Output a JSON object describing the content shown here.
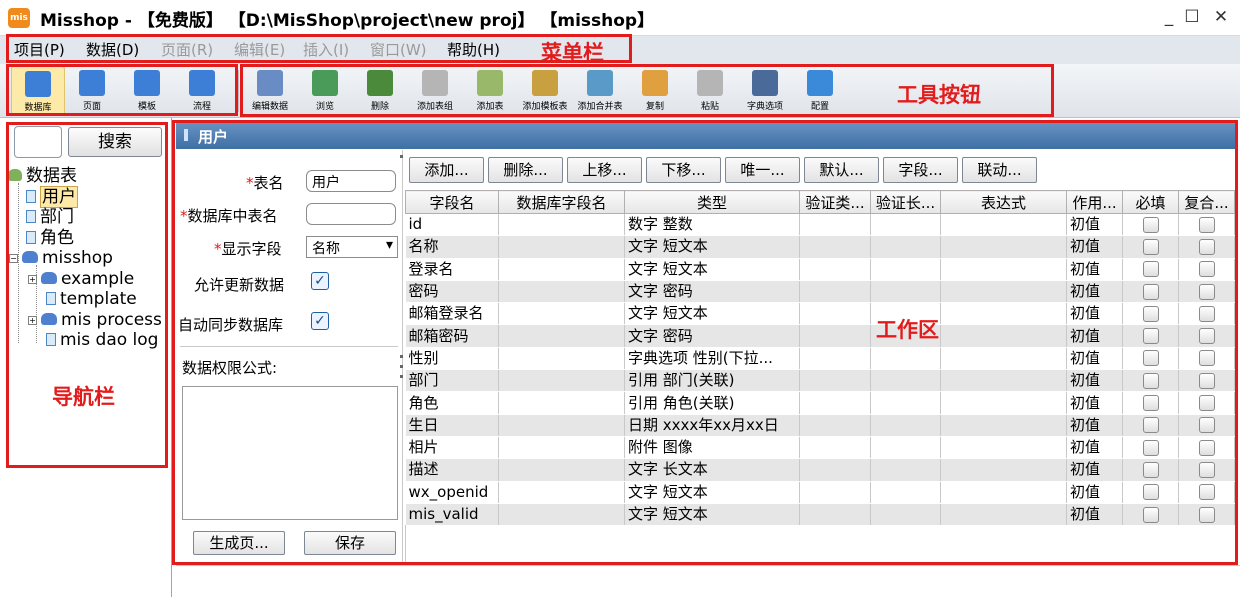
{
  "window": {
    "logo": "mis",
    "title": "Misshop - 【免费版】 【D:\\MisShop\\project\\new proj】 【misshop】",
    "min": "_",
    "max": "☐",
    "close": "✕"
  },
  "menu": {
    "items": [
      {
        "label": "项目(P)"
      },
      {
        "label": "数据(D)"
      },
      {
        "label": "页面(R)"
      },
      {
        "label": "编辑(E)"
      },
      {
        "label": "插入(I)"
      },
      {
        "label": "窗口(W)"
      },
      {
        "label": "帮助(H)"
      }
    ]
  },
  "toolbar": {
    "nav_buttons": [
      {
        "label": "数据库",
        "icon": "database-icon",
        "color": "#3d7fd6"
      },
      {
        "label": "页面",
        "icon": "page-icon",
        "color": "#3d7fd6"
      },
      {
        "label": "模板",
        "icon": "template-icon",
        "color": "#3d7fd6"
      },
      {
        "label": "流程",
        "icon": "flow-icon",
        "color": "#3d7fd6"
      }
    ],
    "tool_buttons": [
      {
        "label": "编辑数据",
        "icon": "edit-data-icon",
        "color": "#6a8cc5"
      },
      {
        "label": "浏览",
        "icon": "browse-icon",
        "color": "#4a9a5a"
      },
      {
        "label": "删除",
        "icon": "delete-icon",
        "color": "#4a8a3a"
      },
      {
        "label": "添加表组",
        "icon": "add-group-icon",
        "color": "#b5b5b5"
      },
      {
        "label": "添加表",
        "icon": "add-table-icon",
        "color": "#9ab86a"
      },
      {
        "label": "添加模板表",
        "icon": "add-template-table-icon",
        "color": "#c9a040"
      },
      {
        "label": "添加合并表",
        "icon": "add-merge-table-icon",
        "color": "#5a9ac9"
      },
      {
        "label": "复制",
        "icon": "copy-icon",
        "color": "#e0a040"
      },
      {
        "label": "粘贴",
        "icon": "paste-icon",
        "color": "#b5b5b5"
      },
      {
        "label": "字典选项",
        "icon": "dictionary-icon",
        "color": "#4a6a9a"
      },
      {
        "label": "配置",
        "icon": "config-icon",
        "color": "#3a8ad9"
      }
    ]
  },
  "annotations": {
    "menubar": "菜单栏",
    "toolbar": "工具按钮",
    "navbar": "导航栏",
    "workarea": "工作区"
  },
  "nav": {
    "search_button": "搜索",
    "tree": [
      {
        "label": "数据表"
      },
      {
        "label": "用户"
      },
      {
        "label": "部门"
      },
      {
        "label": "角色"
      },
      {
        "label": "misshop"
      },
      {
        "label": "example"
      },
      {
        "label": "template"
      },
      {
        "label": "mis process"
      },
      {
        "label": "mis dao log"
      }
    ]
  },
  "main": {
    "title": "用户"
  },
  "form": {
    "table_name_label": "表名",
    "table_name_value": "用户",
    "db_table_name_label": "数据库中表名",
    "db_table_name_value": "",
    "display_field_label": "显示字段",
    "display_field_value": "名称",
    "allow_update_label": "允许更新数据",
    "auto_sync_label": "自动同步数据库",
    "checkmark": "✓",
    "data_permission_label": "数据权限公式:",
    "generate_page_button": "生成页...",
    "save_button": "保存"
  },
  "grid_toolbar": {
    "buttons": [
      "添加...",
      "删除...",
      "上移...",
      "下移...",
      "唯一...",
      "默认...",
      "字段...",
      "联动..."
    ]
  },
  "grid": {
    "columns": [
      "字段名",
      "数据库字段名",
      "类型",
      "验证类...",
      "验证长...",
      "表达式",
      "作用...",
      "必填",
      "复合..."
    ],
    "rows": [
      {
        "field": "id",
        "db_field": "",
        "type": "数字   整数",
        "scope": "初值"
      },
      {
        "field": "名称",
        "db_field": "",
        "type": "文字   短文本",
        "scope": "初值"
      },
      {
        "field": "登录名",
        "db_field": "",
        "type": "文字   短文本",
        "scope": "初值"
      },
      {
        "field": "密码",
        "db_field": "",
        "type": "文字   密码",
        "scope": "初值"
      },
      {
        "field": "邮箱登录名",
        "db_field": "",
        "type": "文字   短文本",
        "scope": "初值"
      },
      {
        "field": "邮箱密码",
        "db_field": "",
        "type": "文字   密码",
        "scope": "初值"
      },
      {
        "field": "性别",
        "db_field": "",
        "type": "字典选项   性别(下拉...",
        "scope": "初值"
      },
      {
        "field": "部门",
        "db_field": "",
        "type": "引用   部门(关联)",
        "scope": "初值"
      },
      {
        "field": "角色",
        "db_field": "",
        "type": "引用   角色(关联)",
        "scope": "初值"
      },
      {
        "field": "生日",
        "db_field": "",
        "type": "日期   xxxx年xx月xx日",
        "scope": "初值"
      },
      {
        "field": "相片",
        "db_field": "",
        "type": "附件   图像",
        "scope": "初值"
      },
      {
        "field": "描述",
        "db_field": "",
        "type": "文字   长文本",
        "scope": "初值"
      },
      {
        "field": "wx_openid",
        "db_field": "",
        "type": "文字   短文本",
        "scope": "初值"
      },
      {
        "field": "mis_valid",
        "db_field": "",
        "type": "文字   短文本",
        "scope": "初值"
      }
    ]
  }
}
